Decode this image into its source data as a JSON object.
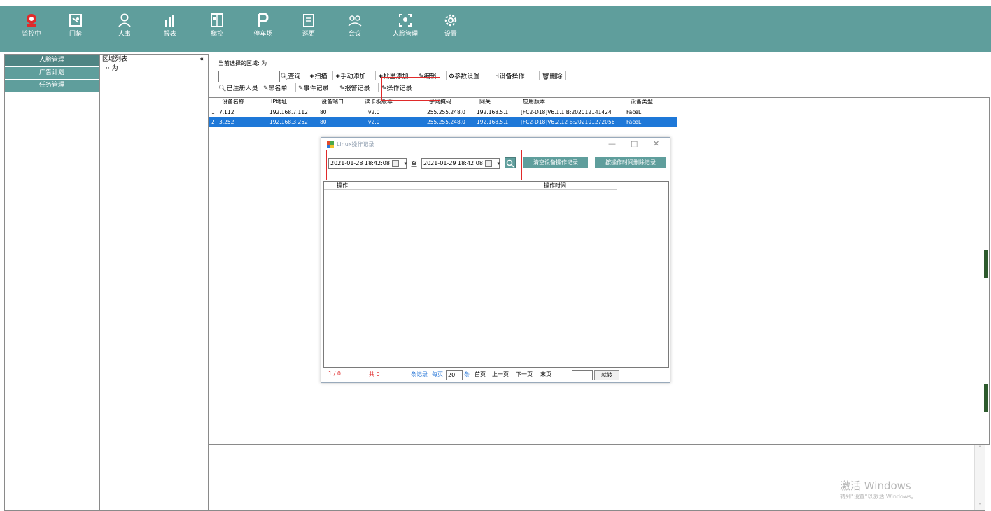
{
  "caption": "",
  "topbar": {
    "items": [
      {
        "label": "监控中",
        "icon": "webcam-icon",
        "color": "#e02a2a"
      },
      {
        "label": "门禁",
        "icon": "door-access-icon"
      },
      {
        "label": "人事",
        "icon": "person-icon"
      },
      {
        "label": "报表",
        "icon": "bar-chart-icon"
      },
      {
        "label": "梯控",
        "icon": "elevator-icon"
      },
      {
        "label": "停车场",
        "icon": "parking-icon"
      },
      {
        "label": "巡更",
        "icon": "patrol-icon"
      },
      {
        "label": "会议",
        "icon": "meeting-icon"
      },
      {
        "label": "人脸管理",
        "icon": "face-icon"
      },
      {
        "label": "设置",
        "icon": "gear-icon"
      }
    ]
  },
  "leftnav": {
    "items": [
      "人脸管理",
      "广告计划",
      "任务管理"
    ]
  },
  "area": {
    "header": "区域列表",
    "collapse": "«",
    "node": "为"
  },
  "toolbar": {
    "current_area_label": "当前选择的区域: 为",
    "search_value": "",
    "query": "查询",
    "scan": "扫描",
    "manual_add": "手动添加",
    "batch_add": "批里添加",
    "edit": "编辑",
    "params": "参数设置",
    "device_op": "设备操作",
    "delete": "删除",
    "registered": "已注册人员",
    "blacklist": "黑名单",
    "events": "事件记录",
    "alarms": "报警记录",
    "oplog": "操作记录"
  },
  "grid": {
    "headers": [
      "设备名称",
      "IP地址",
      "设备端口",
      "读卡板版本",
      "子网掩码",
      "网关",
      "应用版本",
      "设备类型"
    ],
    "rows": [
      [
        "1",
        "7.112",
        "192.168.7.112",
        "80",
        "v2.0",
        "255.255.248.0",
        "192.168.5.1",
        "[FC2-D18]V6.1.1 B:202012141424",
        "FaceL"
      ],
      [
        "2",
        "3.252",
        "192.168.3.252",
        "80",
        "v2.0",
        "255.255.248.0",
        "192.168.5.1",
        "[FC2-D18]V6.2.12 B:202101272056",
        "FaceL"
      ]
    ],
    "selected_row": 2
  },
  "dialog": {
    "title": "Linux操作记录",
    "minimize": "—",
    "maximize": "□",
    "close": "✕",
    "start": "2021-01-28 18:42:08",
    "to": "至",
    "end": "2021-01-29 18:42:08",
    "clear_btn": "清空设备操作记录",
    "delete_by_time_btn": "按操作时间删除记录",
    "col_op": "操作",
    "col_time": "操作时间",
    "pager": {
      "page": "1 / 0",
      "total": "共 0",
      "records": "条记录",
      "per_page_label": "每页",
      "per_page": "20",
      "unit": "条",
      "first": "首页",
      "prev": "上一页",
      "next": "下一页",
      "last": "末页",
      "goto_value": "",
      "goto": "就转"
    }
  },
  "watermark": {
    "line1": "激活 Windows",
    "line2": "转到\"设置\"以激活 Windows。"
  },
  "colors": {
    "teal": "#5f9e9c",
    "selected": "#1e78d8",
    "annotation": "#e02a2a"
  }
}
